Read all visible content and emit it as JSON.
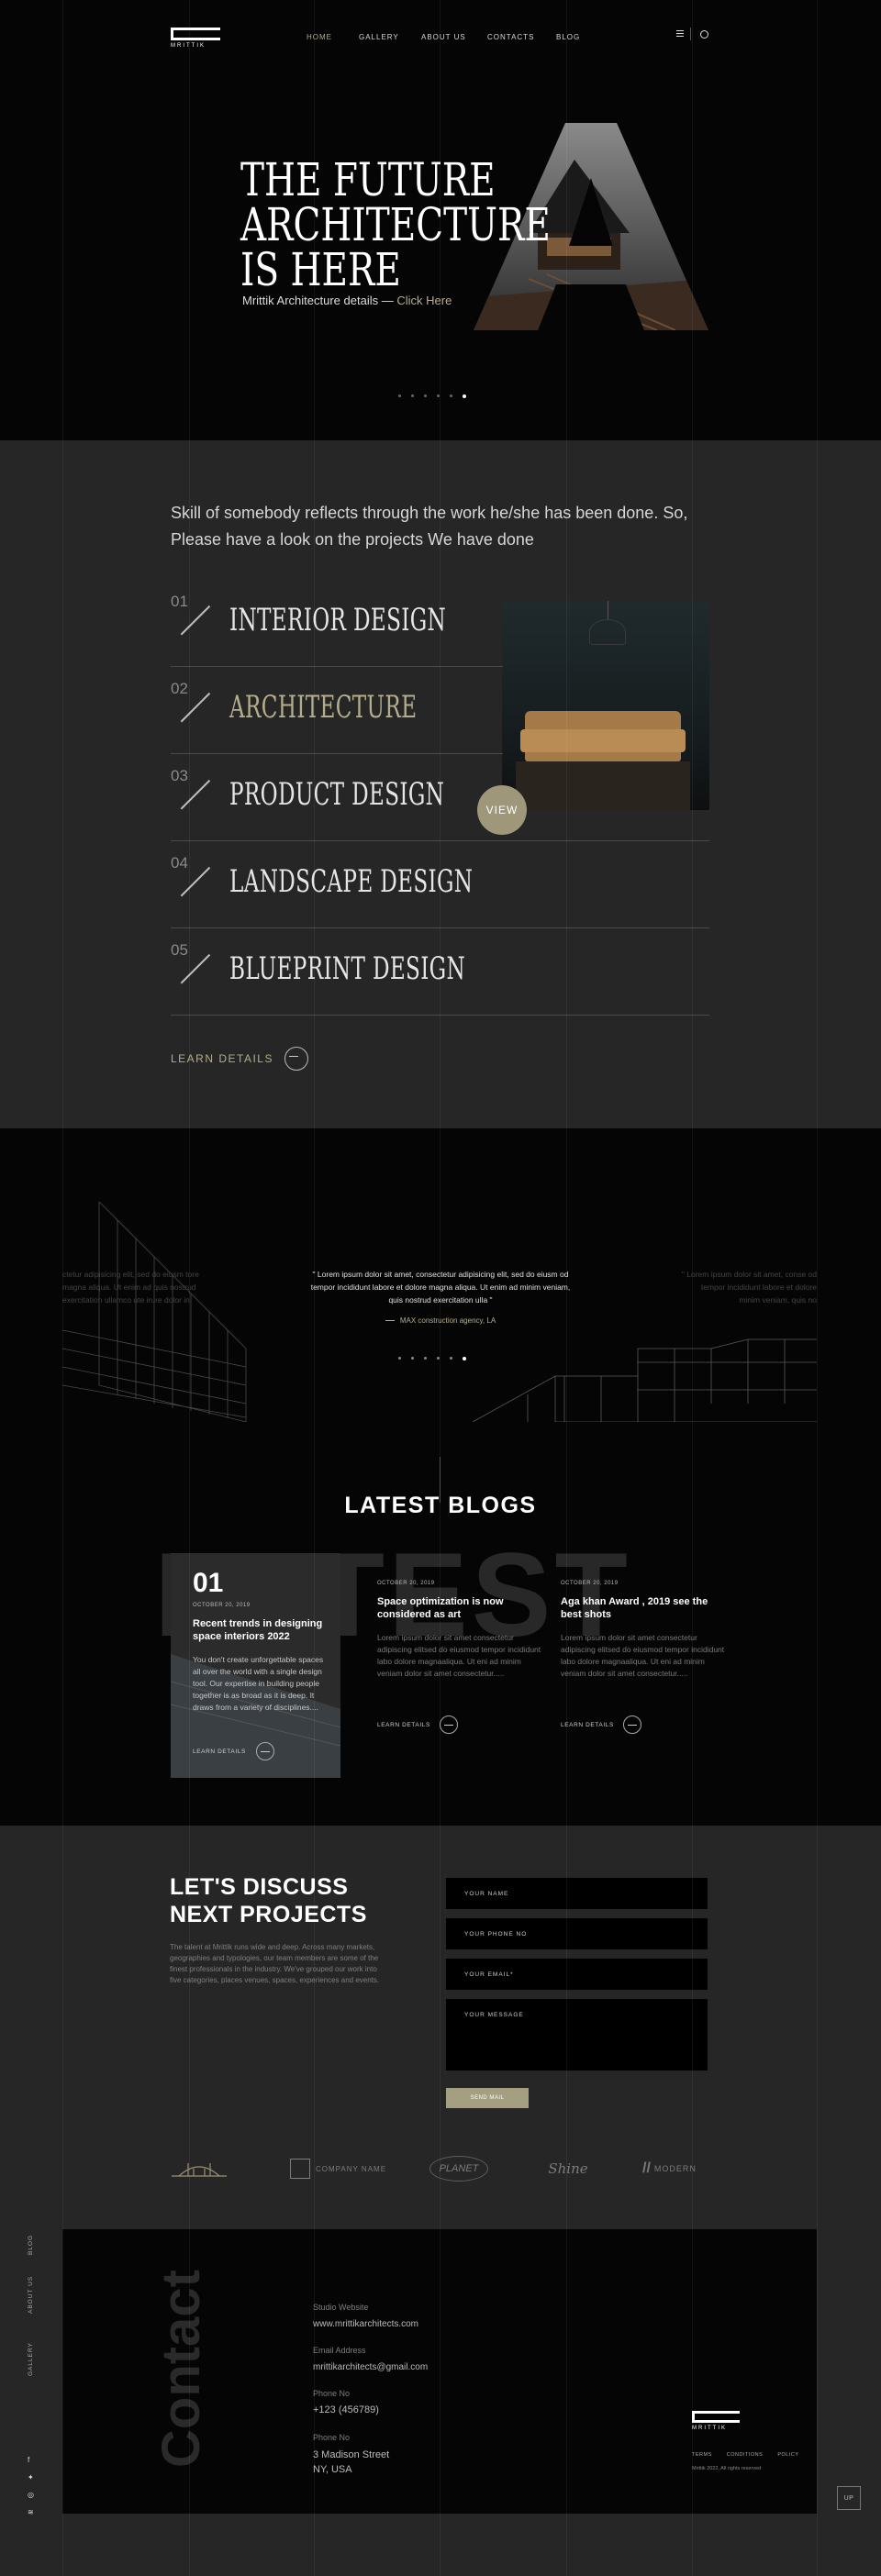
{
  "nav": {
    "logo_text": "Mrittik",
    "links": [
      "HOME",
      "GALLERY",
      "ABOUT US",
      "CONTACTS",
      "BLOG"
    ]
  },
  "hero": {
    "title_lines": [
      "THE FUTURE",
      "ARCHITECTURE",
      "IS HERE"
    ],
    "subtitle": "Mrittik Architecture details —",
    "cta": "Click Here",
    "slides": 6,
    "active_slide": 6
  },
  "services": {
    "intro": "Skill of somebody reflects through the work he/she has been done. So, Please have a look on the projects We have done",
    "items": [
      {
        "num": "01",
        "name": "INTERIOR DESIGN"
      },
      {
        "num": "02",
        "name": "ARCHITECTURE"
      },
      {
        "num": "03",
        "name": "PRODUCT DESIGN"
      },
      {
        "num": "04",
        "name": "LANDSCAPE DESIGN"
      },
      {
        "num": "05",
        "name": "BLUEPRINT DESIGN"
      }
    ],
    "view_label": "VIEW",
    "learn": "LEARN DETAILS"
  },
  "testimonial": {
    "left_quote": "ctetur adipisicing elit, sed do eiusm tore magna aliqua. Ut enim ad quis nostrud exercitation ullamco ute irure dolor in.",
    "quote": "\" Lorem ipsum dolor sit amet, consectetur adipisicing elit, sed do eiusm od tempor incididunt labore et dolore magna aliqua. Ut enim ad minim veniam, quis nostrud exercitation ulla \"",
    "author": "MAX construction agency, LA",
    "right_quote": "\" Lorem ipsum dolor sit amet, conse od tempor incididunt labore et dolore minim veniam, quis no",
    "slides": 6,
    "active_slide": 6
  },
  "blogs": {
    "heading": "LATEST BLOGS",
    "bg_word": "LATEST",
    "cards": [
      {
        "num": "01",
        "date": "OCTOBER 20, 2019",
        "title": "Recent trends in designing space interiors 2022",
        "text": "You don't create unforgettable spaces all over the world with a single design tool. Our expertise in building people together is as broad as it is deep. It draws from a variety of disciplines....",
        "learn": "LEARN DETAILS"
      },
      {
        "date": "OCTOBER 20, 2019",
        "title": "Space optimization is now considered as art",
        "text": "Lorem ipsum dolor sit amet consectetur adipiscing elitsed do eiusmod tempor incididunt labo dolore magnaaliqua. Ut eni ad minim veniam dolor sit amet consectetur.....",
        "learn": "LEARN DETAILS"
      },
      {
        "date": "OCTOBER 20, 2019",
        "title": "Aga khan Award , 2019 see the best shots",
        "text": "Lorem ipsum dolor sit amet consectetur adipiscing elitsed do eiusmod tempor incididunt labo dolore magnaaliqua. Ut eni ad minim veniam dolor sit amet consectetur.....",
        "learn": "LEARN DETAILS"
      }
    ]
  },
  "contact_form": {
    "heading_lines": [
      "LET'S DISCUSS",
      "NEXT PROJECTS"
    ],
    "text": "The talent at Mrittik runs wide and deep. Across many markets, geographies and typologies, our team members are some of the finest professionals in the industry. We've grouped our work into five categories, places venues, spaces, experiences and events.",
    "name_ph": "YOUR NAME",
    "phone_ph": "YOUR PHONE NO",
    "email_ph": "YOUR EMAIL*",
    "message_ph": "YOUR MESSAGE",
    "submit": "SEND MAIL"
  },
  "clients": [
    "",
    "COMPANY NAME",
    "PLANET",
    "Shine",
    "MODERN"
  ],
  "footer": {
    "side_links": [
      "BLOG",
      "ABOUT US",
      "GALLERY"
    ],
    "bg_word": "Contact",
    "studio_label": "Studio Website",
    "studio_value": "www.mrittikarchitects.com",
    "email_label": "Email Address",
    "email_value": "mrittikarchitects@gmail.com",
    "phone_label": "Phone No",
    "phone_value": "+123 (456789)",
    "address_label": "Phone No",
    "address_lines": [
      "3 Madison Street",
      "NY, USA"
    ],
    "logo_text": "Mrittik",
    "links": [
      "TERMS",
      "CONDITIONS",
      "POLICY"
    ],
    "copyright": "Mrittik 2022, All rights reserved",
    "up": "UP"
  },
  "colors": {
    "accent": "#b5ae8c",
    "dark": "#050505",
    "panel": "#262626"
  }
}
